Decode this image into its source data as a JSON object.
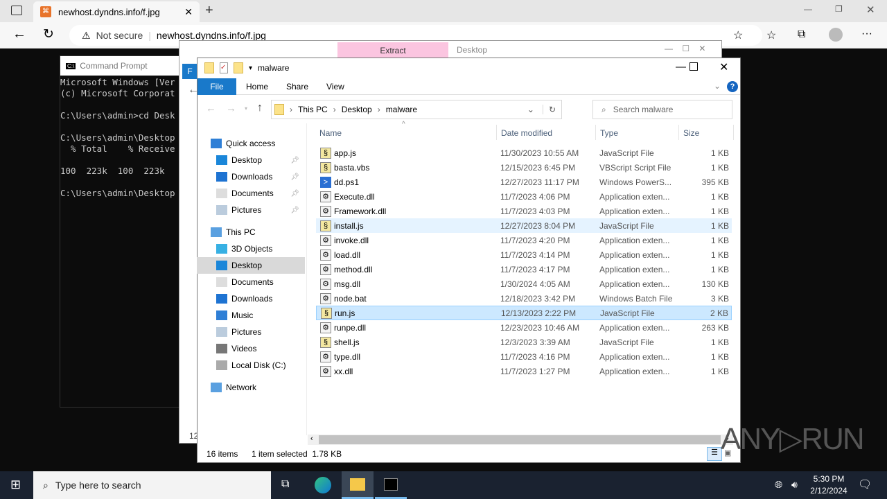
{
  "browser": {
    "tab_title": "newhost.dyndns.info/f.jpg",
    "security": "Not secure",
    "url": "newhost.dyndns.info/f.jpg"
  },
  "cmd": {
    "title": "Command Prompt",
    "lines": [
      "Microsoft Windows [Ver",
      "(c) Microsoft Corporat",
      "",
      "C:\\Users\\admin>cd Desk",
      "",
      "C:\\Users\\admin\\Desktop",
      "  % Total    % Receive",
      "",
      "100  223k  100  223k",
      "",
      "C:\\Users\\admin\\Desktop"
    ]
  },
  "back_window": {
    "context_tab": "Extract",
    "title": "Desktop",
    "ribbon_initial": "F",
    "status_partial": "12"
  },
  "explorer": {
    "title": "malware",
    "ribbon_tabs": [
      "File",
      "Home",
      "Share",
      "View"
    ],
    "breadcrumb": [
      "This PC",
      "Desktop",
      "malware"
    ],
    "search_placeholder": "Search malware",
    "columns": [
      "Name",
      "Date modified",
      "Type",
      "Size"
    ],
    "nav": [
      {
        "label": "Quick access"
      },
      {
        "label": "Desktop"
      },
      {
        "label": "Downloads"
      },
      {
        "label": "Documents"
      },
      {
        "label": "Pictures"
      },
      {
        "label": "This PC"
      },
      {
        "label": "3D Objects"
      },
      {
        "label": "Desktop"
      },
      {
        "label": "Documents"
      },
      {
        "label": "Downloads"
      },
      {
        "label": "Music"
      },
      {
        "label": "Pictures"
      },
      {
        "label": "Videos"
      },
      {
        "label": "Local Disk (C:)"
      },
      {
        "label": "Network"
      }
    ],
    "files": [
      {
        "name": "app.js",
        "date": "11/30/2023 10:55 AM",
        "type": "JavaScript File",
        "size": "1 KB",
        "icon": "script-icon"
      },
      {
        "name": "basta.vbs",
        "date": "12/15/2023 6:45 PM",
        "type": "VBScript Script File",
        "size": "1 KB",
        "icon": "script-icon"
      },
      {
        "name": "dd.ps1",
        "date": "12/27/2023 11:17 PM",
        "type": "Windows PowerS...",
        "size": "395 KB",
        "icon": "powershell-icon"
      },
      {
        "name": "Execute.dll",
        "date": "11/7/2023 4:06 PM",
        "type": "Application exten...",
        "size": "1 KB",
        "icon": "dll-icon"
      },
      {
        "name": "Framework.dll",
        "date": "11/7/2023 4:03 PM",
        "type": "Application exten...",
        "size": "1 KB",
        "icon": "dll-icon"
      },
      {
        "name": "install.js",
        "date": "12/27/2023 8:04 PM",
        "type": "JavaScript File",
        "size": "1 KB",
        "icon": "script-icon"
      },
      {
        "name": "invoke.dll",
        "date": "11/7/2023 4:20 PM",
        "type": "Application exten...",
        "size": "1 KB",
        "icon": "dll-icon"
      },
      {
        "name": "load.dll",
        "date": "11/7/2023 4:14 PM",
        "type": "Application exten...",
        "size": "1 KB",
        "icon": "dll-icon"
      },
      {
        "name": "method.dll",
        "date": "11/7/2023 4:17 PM",
        "type": "Application exten...",
        "size": "1 KB",
        "icon": "dll-icon"
      },
      {
        "name": "msg.dll",
        "date": "1/30/2024 4:05 AM",
        "type": "Application exten...",
        "size": "130 KB",
        "icon": "dll-icon"
      },
      {
        "name": "node.bat",
        "date": "12/18/2023 3:42 PM",
        "type": "Windows Batch File",
        "size": "3 KB",
        "icon": "batch-icon"
      },
      {
        "name": "run.js",
        "date": "12/13/2023 2:22 PM",
        "type": "JavaScript File",
        "size": "2 KB",
        "icon": "script-icon",
        "selected": true
      },
      {
        "name": "runpe.dll",
        "date": "12/23/2023 10:46 AM",
        "type": "Application exten...",
        "size": "263 KB",
        "icon": "dll-icon"
      },
      {
        "name": "shell.js",
        "date": "12/3/2023 3:39 AM",
        "type": "JavaScript File",
        "size": "1 KB",
        "icon": "script-icon"
      },
      {
        "name": "type.dll",
        "date": "11/7/2023 4:16 PM",
        "type": "Application exten...",
        "size": "1 KB",
        "icon": "dll-icon"
      },
      {
        "name": "xx.dll",
        "date": "11/7/2023 1:27 PM",
        "type": "Application exten...",
        "size": "1 KB",
        "icon": "dll-icon"
      }
    ],
    "status": {
      "count": "16 items",
      "selection": "1 item selected  1.78 KB"
    }
  },
  "taskbar": {
    "search_placeholder": "Type here to search",
    "time": "5:30 PM",
    "date": "2/12/2024"
  },
  "watermark": "ANY RUN"
}
